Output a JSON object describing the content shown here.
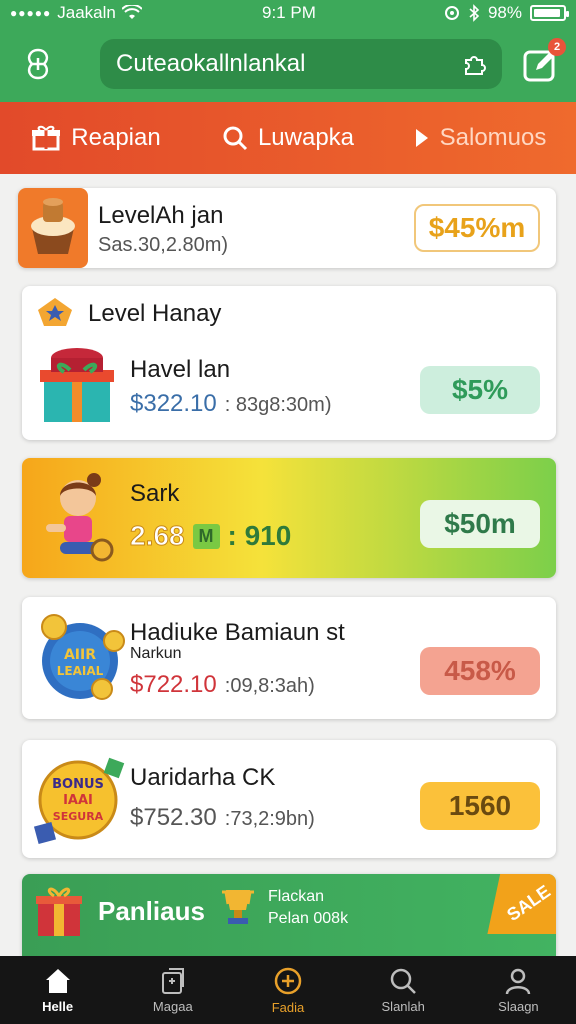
{
  "status": {
    "carrier": "Jaakaln",
    "time": "9:1 PM",
    "battery": "98%",
    "battery_level": 0.92
  },
  "header": {
    "search_text": "Cuteaokallnlankal",
    "badge": "2"
  },
  "tabs": [
    {
      "label": "Reapian",
      "icon": "gift-icon",
      "active": true
    },
    {
      "label": "Luwapka",
      "icon": "search-icon",
      "active": false
    },
    {
      "label": "Salomuos",
      "icon": "play-icon",
      "active": false
    }
  ],
  "cards": [
    {
      "title": "LevelAh jan",
      "subtitle": "Sas.30,2.80m)",
      "badge": "$45%m",
      "icon": "cupcake-icon"
    },
    {
      "section": "Level Hanay",
      "title": "Havel lan",
      "price": "$322.10",
      "detail": ": 83g8:30m)",
      "badge": "$5%",
      "icon": "gift-box-icon"
    },
    {
      "title": "Sark",
      "price": "2.68",
      "mid_badge": "M",
      "value": ": 910",
      "badge": "$50m",
      "icon": "character-icon"
    },
    {
      "title": "Hadiuke Bamiaun st",
      "subtitle": "Narkun",
      "price": "$722.10",
      "detail": ":09,8:3ah)",
      "badge": "458%",
      "icon": "coin-badge-icon",
      "emblem": "AIIR\nLEAIAL"
    },
    {
      "title": "Uaridarha CK",
      "price": "$752.30",
      "detail": ":73,2:9bn)",
      "badge": "1560",
      "icon": "sale-badge-icon",
      "emblem": "BONUS\nIAAI\nSEGURA"
    }
  ],
  "promo": {
    "label": "Panliaus",
    "line1": "Flackan",
    "line2": "Pelan 008k",
    "ribbon": "SALE"
  },
  "nav": [
    {
      "label": "Helle",
      "icon": "home-icon"
    },
    {
      "label": "Magaa",
      "icon": "document-icon"
    },
    {
      "label": "Fadia",
      "icon": "plus-circle-icon"
    },
    {
      "label": "Slanlah",
      "icon": "search-icon"
    },
    {
      "label": "Slaagn",
      "icon": "user-icon"
    }
  ],
  "colors": {
    "header_green": "#3da95a",
    "tab_orange": "#e24a2a",
    "price_blue": "#3a6ea8",
    "price_red": "#d0343a",
    "pill_orange": "#e8a21a",
    "pill_green": "#cdeedd",
    "pill_red": "#f4a391",
    "pill_yellow": "#fbc13a"
  }
}
